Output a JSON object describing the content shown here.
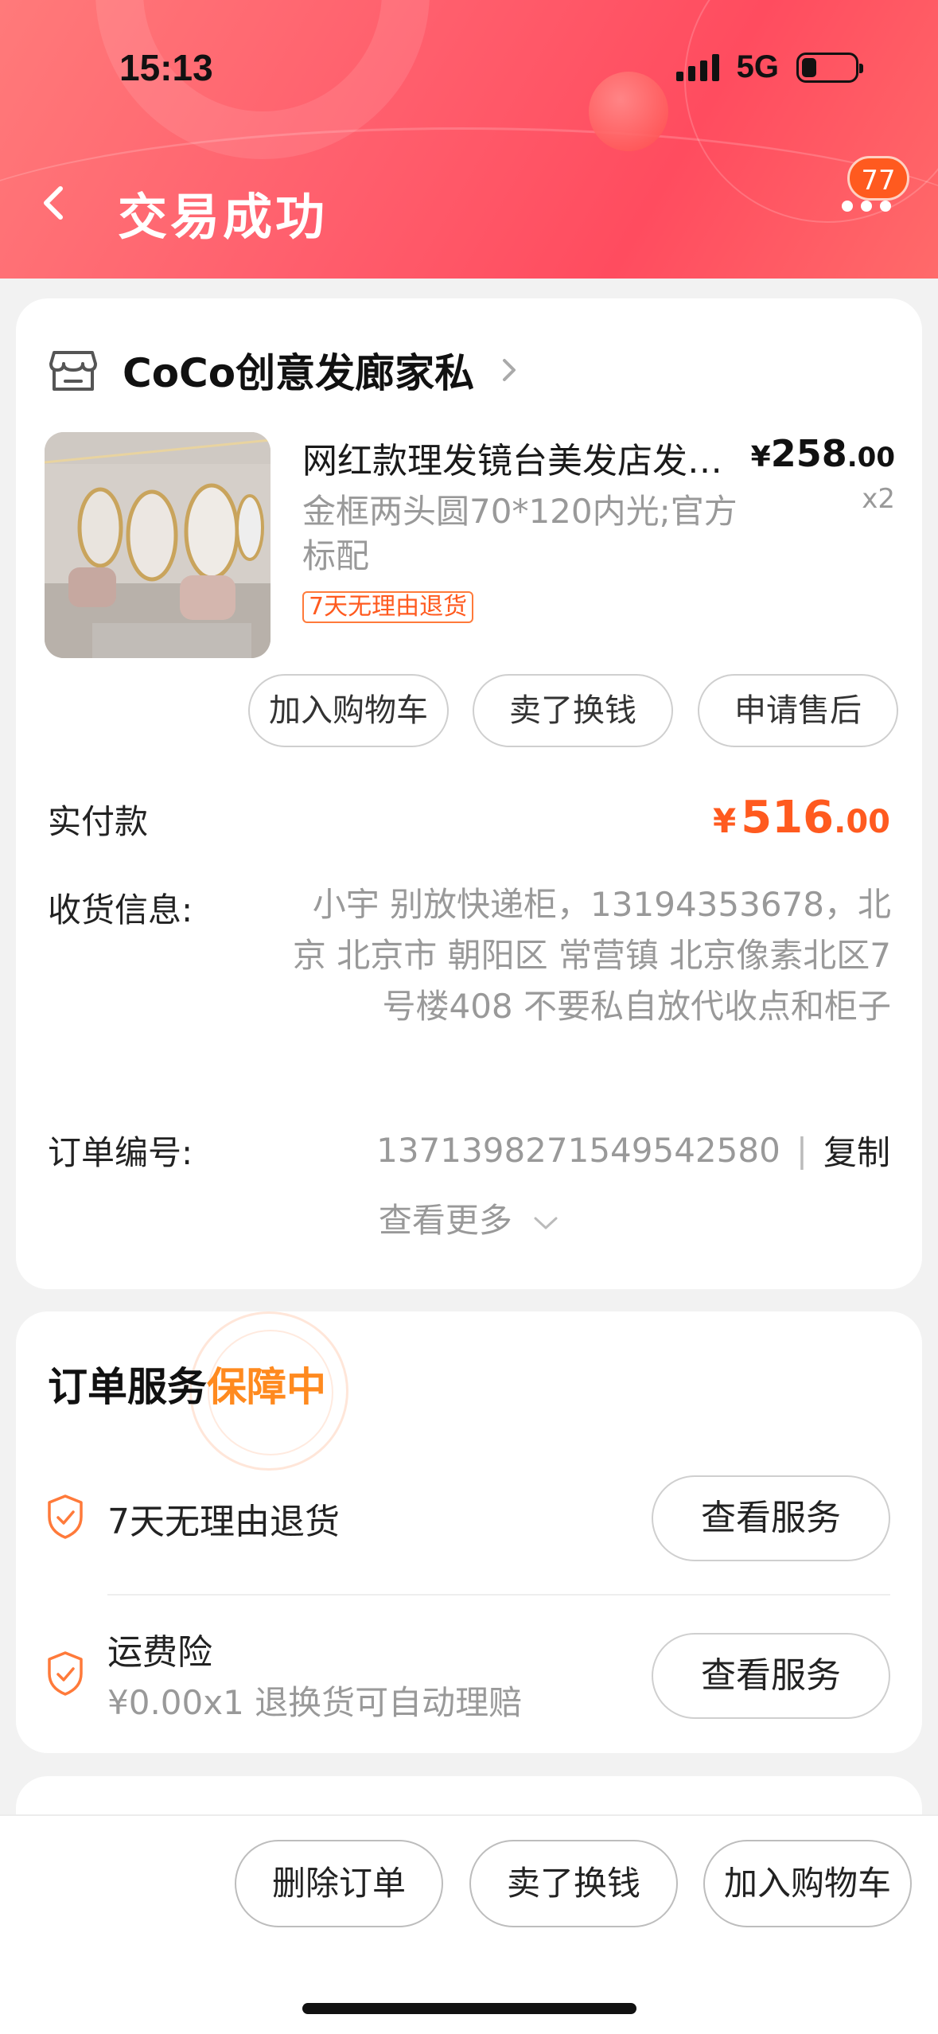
{
  "status_bar": {
    "time": "15:13",
    "network": "5G"
  },
  "header": {
    "title": "交易成功",
    "badge_count": "77",
    "back_icon": "chevron-left-icon",
    "more_icon": "more-dots-icon"
  },
  "shop": {
    "name": "CoCo创意发廊家私"
  },
  "product": {
    "title": "网红款理发镜台美发店发…",
    "spec": "金框两头圆70*120内光;官方标配",
    "tag": "7天无理由退货",
    "price_symbol": "¥",
    "price_int": "258",
    "price_dec": ".00",
    "quantity": "x2"
  },
  "item_actions": {
    "add_cart": "加入购物车",
    "sell": "卖了换钱",
    "after_sale": "申请售后"
  },
  "order": {
    "paid_label": "实付款",
    "paid_symbol": "¥",
    "paid_int": "516",
    "paid_dec": ".00",
    "address_label": "收货信息:",
    "address_value": "小宇 别放快递柜，13194353678，北京 北京市 朝阳区    常营镇 北京像素北区7号楼408 不要私自放代收点和柜子",
    "order_no_label": "订单编号:",
    "order_no_value": "1371398271549542580",
    "order_no_sep": "|",
    "copy_label": "复制",
    "see_more": "查看更多"
  },
  "services": {
    "title_prefix": "订单服务",
    "title_highlight": "保障中",
    "items": [
      {
        "name": "7天无理由退货",
        "sub": "",
        "button": "查看服务"
      },
      {
        "name": "运费险",
        "sub": "¥0.00x1 退换货可自动理赔",
        "button": "查看服务"
      }
    ]
  },
  "bottom_bar": {
    "delete": "删除订单",
    "sell": "卖了换钱",
    "add_cart": "加入购物车"
  },
  "colors": {
    "accent": "#ff5a1f",
    "header": "#ff5f6d",
    "highlight": "#ff8a1f"
  }
}
